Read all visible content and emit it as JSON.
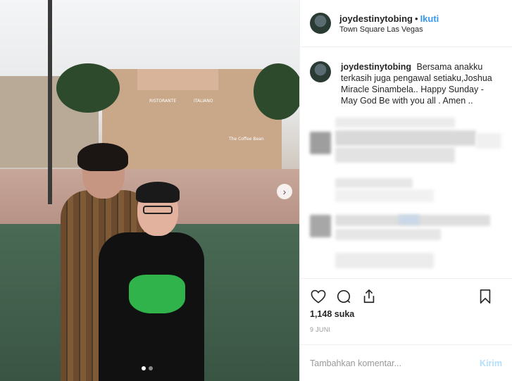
{
  "header": {
    "username": "joydestinytobing",
    "separator": "•",
    "follow_label": "Ikuti",
    "location": "Town Square Las Vegas"
  },
  "photo": {
    "signs": [
      "RISTORANTE",
      "ITALIANO",
      "The Coffee Bean"
    ],
    "carousel_dots": 2,
    "active_dot": 1
  },
  "caption": {
    "username": "joydestinytobing",
    "text": "Bersama anakku terkasih juga pengawal setiaku,Joshua Miracle Sinambela.. Happy Sunday - May God Be with you all . Amen .."
  },
  "stats": {
    "likes": "1,148 suka",
    "date": "9 JUNI"
  },
  "comment": {
    "placeholder": "Tambahkan komentar...",
    "post_label": "Kirim"
  },
  "colors": {
    "accent": "#3897f0",
    "post_disabled": "#b2dffc",
    "border": "#efefef"
  }
}
